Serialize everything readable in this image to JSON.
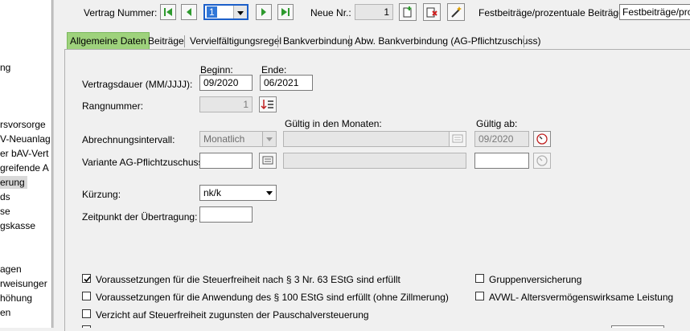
{
  "sidebar": {
    "items": [
      {
        "label": "ng",
        "y": 0
      },
      {
        "label": "rsvorsorge"
      },
      {
        "label": "V-Neuanlag"
      },
      {
        "label": "er bAV-Vert"
      },
      {
        "label": "greifende A"
      },
      {
        "label": "erung"
      },
      {
        "label": "ds"
      },
      {
        "label": "se"
      },
      {
        "label": "gskasse"
      },
      {
        "label": "agen"
      },
      {
        "label": "rweisunger"
      },
      {
        "label": "höhung"
      },
      {
        "label": "en"
      }
    ]
  },
  "toolbar": {
    "vertrag_label": "Vertrag Nummer:",
    "vertrag_value": "1",
    "neue_nr_label": "Neue Nr.:",
    "neue_nr_value": "1",
    "festbeitraege_label": "Festbeiträge/prozentuale Beiträge:",
    "festbeitraege_value": "Festbeiträge/proz"
  },
  "tabs": [
    {
      "label": "Allgemeine Daten",
      "active": true
    },
    {
      "label": "Beiträge"
    },
    {
      "label": "Vervielfältigungsregel"
    },
    {
      "label": "Bankverbindung"
    },
    {
      "label": "Abw. Bankverbindung (AG-Pflichtzuschuss)"
    }
  ],
  "form": {
    "beginn_label": "Beginn:",
    "ende_label": "Ende:",
    "vertragsdauer_label": "Vertragsdauer (MM/JJJJ):",
    "beginn_value": "09/2020",
    "ende_value": "06/2021",
    "rangnummer_label": "Rangnummer:",
    "rangnummer_value": "1",
    "gueltig_monaten_label": "Gültig in den Monaten:",
    "gueltig_ab_label": "Gültig ab:",
    "abrechnung_label": "Abrechnungsintervall:",
    "abrechnung_value": "Monatlich",
    "gueltig_ab_value": "09/2020",
    "variante_label": "Variante AG-Pflichtzuschuss:",
    "kuerzung_label": "Kürzung:",
    "kuerzung_value": "nk/k",
    "zeitpunkt_label": "Zeitpunkt der Übertragung:"
  },
  "checkboxes": [
    {
      "label": "Voraussetzungen für die Steuerfreiheit nach § 3 Nr. 63 EStG sind erfüllt",
      "checked": true
    },
    {
      "label": "Voraussetzungen für die Anwendung des § 100 EStG sind erfüllt (ohne Zillmerung)",
      "checked": false
    },
    {
      "label": "Verzicht auf Steuerfreiheit zugunsten der Pauschalversteuerung",
      "checked": false
    },
    {
      "label": "Gruppenversicherung",
      "checked": false
    },
    {
      "label": "AVWL- Altersvermögenswirksame Leistung",
      "checked": false
    }
  ],
  "colors": {
    "active_tab": "#9ed27c",
    "nav_green": "#2e9a2e"
  }
}
